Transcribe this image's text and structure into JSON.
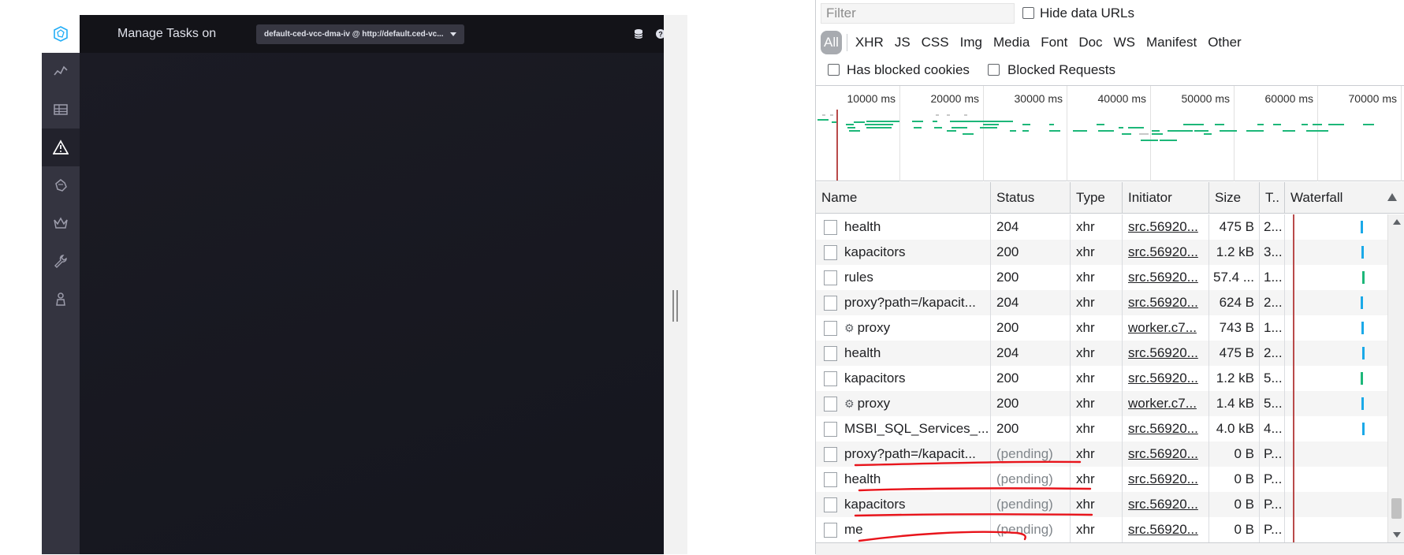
{
  "app": {
    "title": "Manage Tasks on",
    "source": "default-ced-vcc-dma-iv @ http://default.ced-vc...",
    "colors": {
      "topbar": "#131318",
      "sidebar": "#343440",
      "content": "#1b1b25"
    },
    "nav": [
      {
        "icon": "pulse-icon",
        "active": false
      },
      {
        "icon": "dashboards-icon",
        "active": false
      },
      {
        "icon": "alert-icon",
        "active": true
      },
      {
        "icon": "kapacitor-icon",
        "active": false
      },
      {
        "icon": "crown-icon",
        "active": false
      },
      {
        "icon": "wrench-icon",
        "active": false
      },
      {
        "icon": "user-icon",
        "active": false
      }
    ]
  },
  "devtools": {
    "filter_placeholder": "Filter",
    "hide_data_urls": "Hide data URLs",
    "has_blocked_cookies": "Has blocked cookies",
    "blocked_requests": "Blocked Requests",
    "type_filters": [
      "All",
      "XHR",
      "JS",
      "CSS",
      "Img",
      "Media",
      "Font",
      "Doc",
      "WS",
      "Manifest",
      "Other"
    ],
    "overview_ticks": [
      "10000 ms",
      "20000 ms",
      "30000 ms",
      "40000 ms",
      "50000 ms",
      "60000 ms",
      "70000 ms"
    ],
    "columns": [
      "Name",
      "Status",
      "Type",
      "Initiator",
      "Size",
      "T..",
      "Waterfall"
    ],
    "rows": [
      {
        "name": "health",
        "worker": false,
        "status": "204",
        "type": "xhr",
        "initiator": "src.56920...",
        "size": "475 B",
        "time": "2...",
        "pending": false,
        "bar": "blue"
      },
      {
        "name": "kapacitors",
        "worker": false,
        "status": "200",
        "type": "xhr",
        "initiator": "src.56920...",
        "size": "1.2 kB",
        "time": "3...",
        "pending": false,
        "bar": "blue"
      },
      {
        "name": "rules",
        "worker": false,
        "status": "200",
        "type": "xhr",
        "initiator": "src.56920...",
        "size": "57.4 ...",
        "time": "1...",
        "pending": false,
        "bar": "green"
      },
      {
        "name": "proxy?path=/kapacit...",
        "worker": false,
        "status": "204",
        "type": "xhr",
        "initiator": "src.56920...",
        "size": "624 B",
        "time": "2...",
        "pending": false,
        "bar": "blue"
      },
      {
        "name": "proxy",
        "worker": true,
        "status": "200",
        "type": "xhr",
        "initiator": "worker.c7...",
        "size": "743 B",
        "time": "1...",
        "pending": false,
        "bar": "blue"
      },
      {
        "name": "health",
        "worker": false,
        "status": "204",
        "type": "xhr",
        "initiator": "src.56920...",
        "size": "475 B",
        "time": "2...",
        "pending": false,
        "bar": "blue"
      },
      {
        "name": "kapacitors",
        "worker": false,
        "status": "200",
        "type": "xhr",
        "initiator": "src.56920...",
        "size": "1.2 kB",
        "time": "5...",
        "pending": false,
        "bar": "green"
      },
      {
        "name": "proxy",
        "worker": true,
        "status": "200",
        "type": "xhr",
        "initiator": "worker.c7...",
        "size": "1.4 kB",
        "time": "5...",
        "pending": false,
        "bar": "blue"
      },
      {
        "name": "MSBI_SQL_Services_...",
        "worker": false,
        "status": "200",
        "type": "xhr",
        "initiator": "src.56920...",
        "size": "4.0 kB",
        "time": "4...",
        "pending": false,
        "bar": "blue"
      },
      {
        "name": "proxy?path=/kapacit...",
        "worker": false,
        "status": "(pending)",
        "type": "xhr",
        "initiator": "src.56920...",
        "size": "0 B",
        "time": "P...",
        "pending": true,
        "bar": ""
      },
      {
        "name": "health",
        "worker": false,
        "status": "(pending)",
        "type": "xhr",
        "initiator": "src.56920...",
        "size": "0 B",
        "time": "P...",
        "pending": true,
        "bar": ""
      },
      {
        "name": "kapacitors",
        "worker": false,
        "status": "(pending)",
        "type": "xhr",
        "initiator": "src.56920...",
        "size": "0 B",
        "time": "P...",
        "pending": true,
        "bar": ""
      },
      {
        "name": "me",
        "worker": false,
        "status": "(pending)",
        "type": "xhr",
        "initiator": "src.56920...",
        "size": "0 B",
        "time": "P...",
        "pending": true,
        "bar": ""
      }
    ]
  },
  "annotation_color": "#e8141b"
}
